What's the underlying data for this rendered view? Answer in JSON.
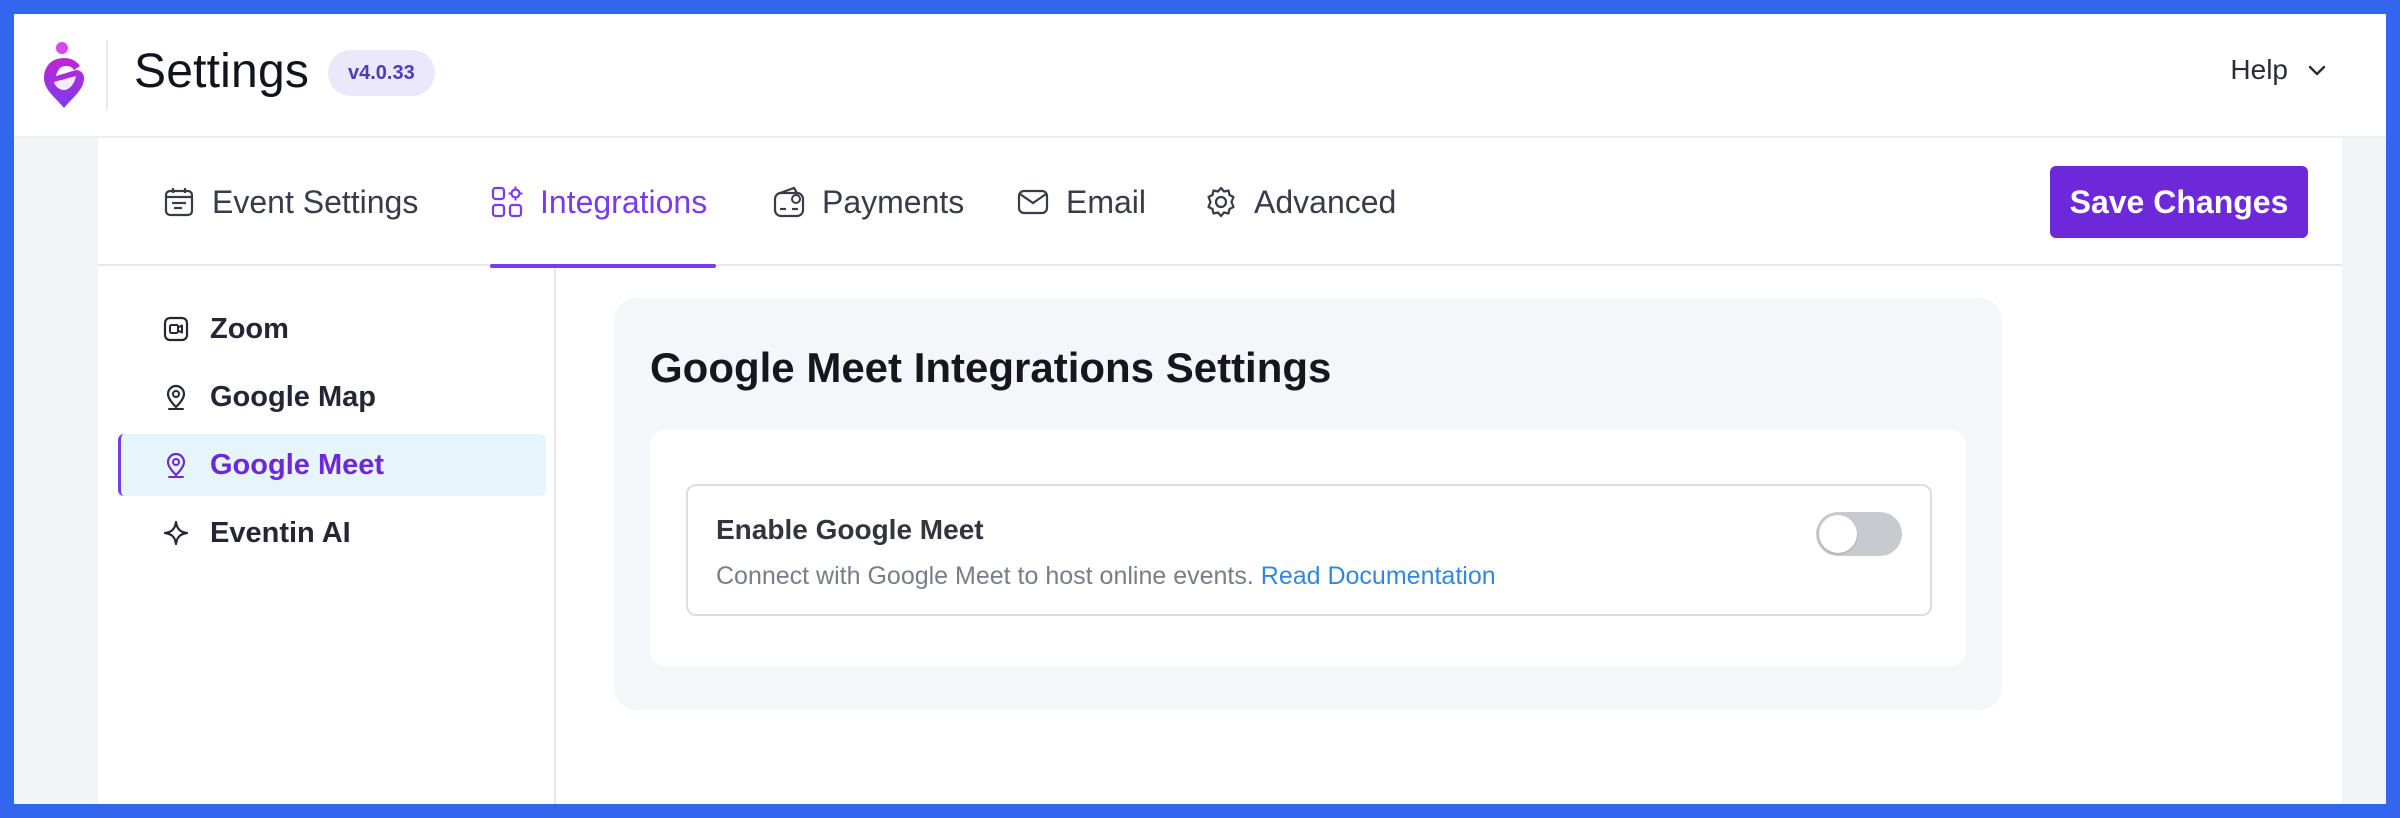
{
  "app": {
    "title": "Settings",
    "version": "v4.0.33",
    "help_label": "Help"
  },
  "tabs": [
    {
      "label": "Event Settings",
      "icon": "calendar-icon",
      "active": false
    },
    {
      "label": "Integrations",
      "icon": "apps-icon",
      "active": true
    },
    {
      "label": "Payments",
      "icon": "wallet-icon",
      "active": false
    },
    {
      "label": "Email",
      "icon": "mail-icon",
      "active": false
    },
    {
      "label": "Advanced",
      "icon": "gear-icon",
      "active": false
    }
  ],
  "save_button": {
    "label": "Save Changes"
  },
  "sidebar": {
    "items": [
      {
        "label": "Zoom",
        "icon": "video-icon",
        "active": false
      },
      {
        "label": "Google Map",
        "icon": "map-pin-icon",
        "active": false
      },
      {
        "label": "Google Meet",
        "icon": "map-pin-icon",
        "active": true
      },
      {
        "label": "Eventin AI",
        "icon": "sparkle-icon",
        "active": false
      }
    ]
  },
  "main": {
    "title": "Google Meet Integrations Settings",
    "setting": {
      "label": "Enable Google Meet",
      "description": "Connect with Google Meet to host online events.",
      "link_text": "Read Documentation",
      "enabled": false
    }
  },
  "colors": {
    "accent": "#7c3aed",
    "button": "#6d28d9",
    "link": "#3088e0",
    "frame": "#3366ee"
  }
}
